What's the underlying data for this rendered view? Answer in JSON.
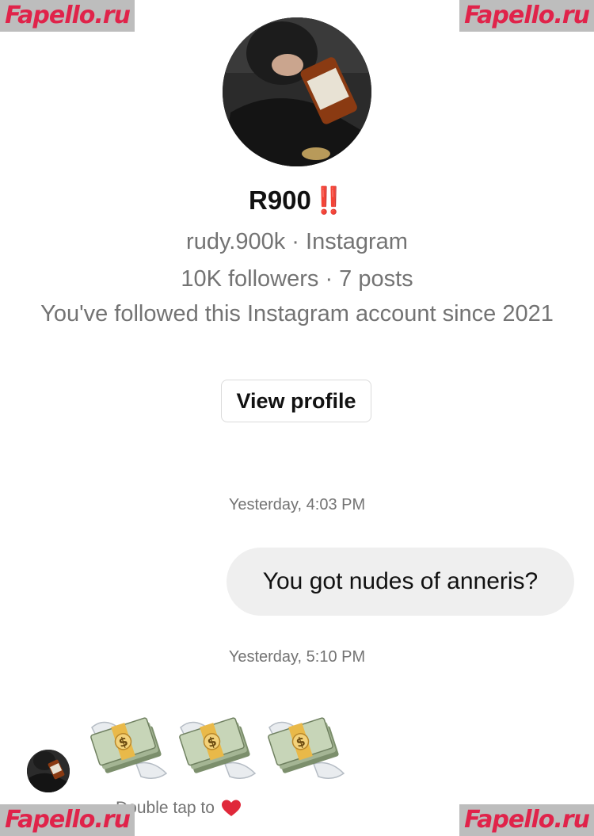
{
  "watermark": {
    "text": "Fapello.ru"
  },
  "profile": {
    "display_name": "R900",
    "name_emoji": "‼️",
    "handle_line": "rudy.900k · Instagram",
    "stats_line": "10K followers · 7 posts",
    "followed_line": "You've followed this Instagram account since 2021",
    "view_profile_label": "View profile"
  },
  "thread": {
    "timestamp_1": "Yesterday, 4:03 PM",
    "outgoing_message": "You got nudes of anneris?",
    "timestamp_2": "Yesterday, 5:10 PM",
    "incoming_emojis": [
      "money-with-wings",
      "money-with-wings",
      "money-with-wings"
    ],
    "reaction_hint": "Double tap to"
  },
  "colors": {
    "accent_red": "#e02a2a",
    "bubble_bg": "#efefef",
    "muted_text": "#737373",
    "watermark_text": "#e0234a"
  }
}
